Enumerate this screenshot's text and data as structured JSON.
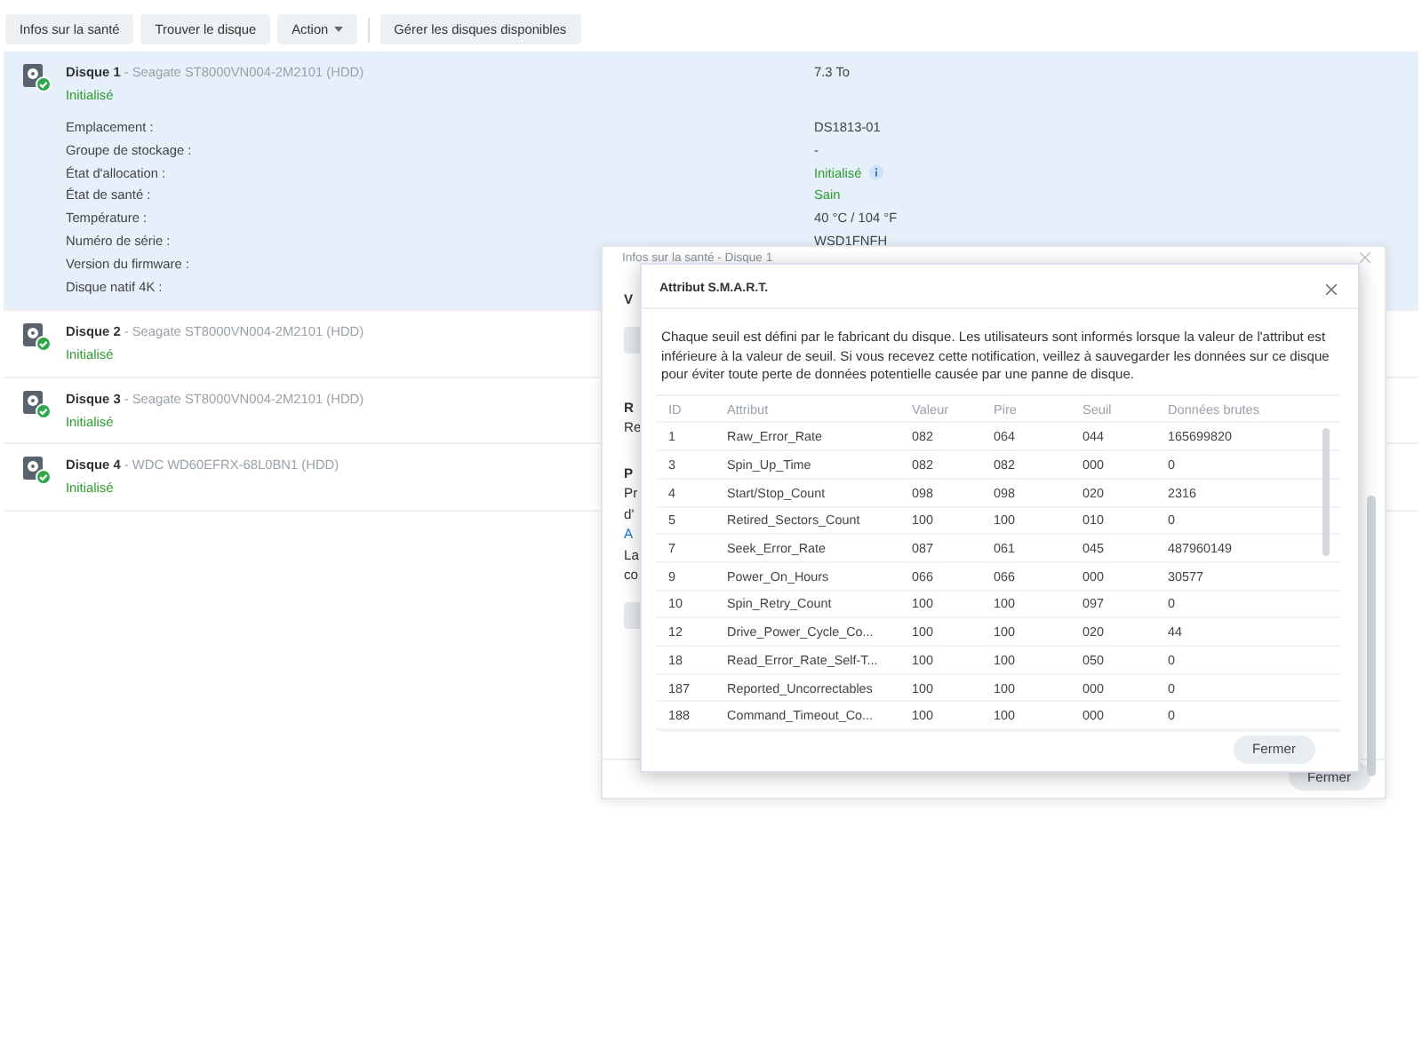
{
  "toolbar": [
    {
      "kind": "button",
      "label": "Infos sur la santé"
    },
    {
      "kind": "button",
      "label": "Trouver le disque"
    },
    {
      "kind": "dropdown",
      "label": "Action"
    },
    {
      "kind": "separator"
    },
    {
      "kind": "button",
      "label": "Gérer les disques disponibles"
    }
  ],
  "disks": [
    {
      "name": "Disque 1",
      "model": " - Seagate ST8000VN004-2M2101 (HDD)",
      "status": "Initialisé",
      "capacity": "7.3 To",
      "selected": true,
      "details": [
        {
          "label": "Emplacement :",
          "value": "DS1813-01",
          "kind": "plain"
        },
        {
          "label": "Groupe de stockage :",
          "value": "-",
          "kind": "plain"
        },
        {
          "label": "État d'allocation :",
          "value": "Initialisé",
          "kind": "good-info"
        },
        {
          "label": "État de santé :",
          "value": "Sain",
          "kind": "good"
        },
        {
          "label": "Température :",
          "value": "40 °C / 104 °F",
          "kind": "plain"
        },
        {
          "label": "Numéro de série :",
          "value": "WSD1FNFH",
          "kind": "plain"
        },
        {
          "label": "Version du firmware :"
        },
        {
          "label": "Disque natif 4K :"
        }
      ]
    },
    {
      "name": "Disque 2",
      "model": " - Seagate ST8000VN004-2M2101 (HDD)",
      "status": "Initialisé",
      "selected": false
    },
    {
      "name": "Disque 3",
      "model": " - Seagate ST8000VN004-2M2101 (HDD)",
      "status": "Initialisé",
      "selected": false
    },
    {
      "name": "Disque 4",
      "model": " - WDC WD60EFRX-68L0BN1 (HDD)",
      "status": "Initialisé",
      "selected": false
    }
  ],
  "health_dialog": {
    "title": "Infos sur la santé - Disque 1",
    "fragments": [
      {
        "kind": "heading",
        "text": "V"
      },
      {
        "kind": "button"
      },
      {
        "kind": "heading",
        "text": "R"
      },
      {
        "kind": "text",
        "text": "Re"
      },
      {
        "kind": "heading",
        "text": "P"
      },
      {
        "kind": "text",
        "text": "Pr"
      },
      {
        "kind": "text",
        "text": "d'"
      },
      {
        "kind": "link",
        "text": "A"
      },
      {
        "kind": "text",
        "text": "La"
      },
      {
        "kind": "text",
        "text": "co"
      },
      {
        "kind": "button"
      }
    ],
    "close_button": "Fermer"
  },
  "smart_dialog": {
    "title": "Attribut S.M.A.R.T.",
    "description": "Chaque seuil est défini par le fabricant du disque. Les utilisateurs sont informés lorsque la valeur de l'attribut est inférieure à la valeur de seuil. Si vous recevez cette notification, veillez à sauvegarder les données sur ce disque pour éviter toute perte de données potentielle causée par une panne de disque.",
    "columns": [
      "ID",
      "Attribut",
      "Valeur",
      "Pire",
      "Seuil",
      "Données brutes"
    ],
    "rows": [
      [
        "1",
        "Raw_Error_Rate",
        "082",
        "064",
        "044",
        "165699820"
      ],
      [
        "3",
        "Spin_Up_Time",
        "082",
        "082",
        "000",
        "0"
      ],
      [
        "4",
        "Start/Stop_Count",
        "098",
        "098",
        "020",
        "2316"
      ],
      [
        "5",
        "Retired_Sectors_Count",
        "100",
        "100",
        "010",
        "0"
      ],
      [
        "7",
        "Seek_Error_Rate",
        "087",
        "061",
        "045",
        "487960149"
      ],
      [
        "9",
        "Power_On_Hours",
        "066",
        "066",
        "000",
        "30577"
      ],
      [
        "10",
        "Spin_Retry_Count",
        "100",
        "100",
        "097",
        "0"
      ],
      [
        "12",
        "Drive_Power_Cycle_Co...",
        "100",
        "100",
        "020",
        "44"
      ],
      [
        "18",
        "Read_Error_Rate_Self-T...",
        "100",
        "100",
        "050",
        "0"
      ],
      [
        "187",
        "Reported_Uncorrectables",
        "100",
        "100",
        "000",
        "0"
      ],
      [
        "188",
        "Command_Timeout_Co...",
        "100",
        "100",
        "000",
        "0"
      ]
    ],
    "close_button": "Fermer"
  }
}
